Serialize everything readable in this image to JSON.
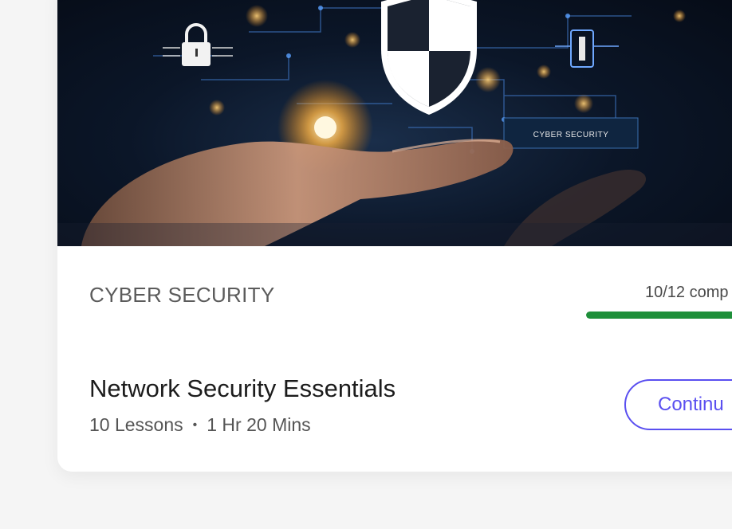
{
  "course": {
    "category": "CYBER SECURITY",
    "title": "Network Security Essentials",
    "lessons": "10 Lessons",
    "duration": "1 Hr 20 Mins",
    "separator": "•",
    "progress_text": "10/12 comp",
    "progress_fraction": 0.8333,
    "continue_label": "Continu",
    "image_caption": "CYBER SECURITY"
  },
  "colors": {
    "progress": "#1e8f3a",
    "accent": "#5a4ff0"
  }
}
